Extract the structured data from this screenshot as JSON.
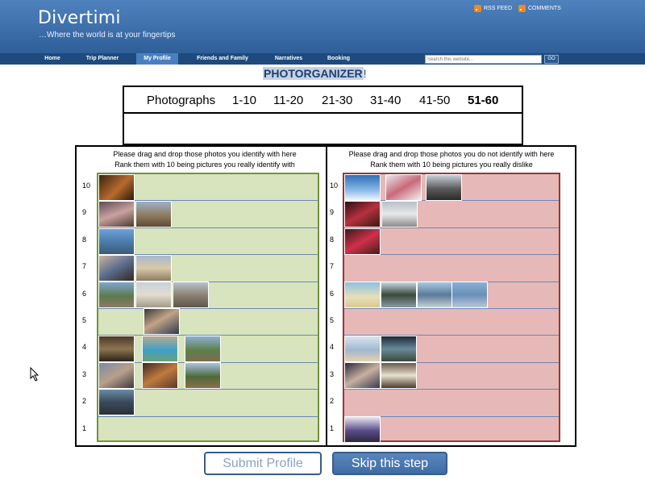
{
  "header": {
    "site_title": "Divertimi",
    "tagline": "…Where the world is at your fingertips",
    "rss_feed": "RSS FEED",
    "comments": "COMMENTS",
    "bg_color": "#3a6ba8"
  },
  "nav": {
    "items": [
      {
        "label": "Home"
      },
      {
        "label": "Trip Planner"
      },
      {
        "label": "My Profile",
        "active": true
      },
      {
        "label": "Friends and Family"
      },
      {
        "label": "Narratives"
      },
      {
        "label": "Booking"
      }
    ],
    "search_placeholder": "Search this website...",
    "go_label": "GO"
  },
  "organizer": {
    "title_word": "PHOTORGANIZER",
    "title_excl": "!",
    "ranges_prefix": "Photographs",
    "ranges": [
      "1-10",
      "11-20",
      "21-30",
      "31-40",
      "41-50",
      "51-60"
    ],
    "active_range": "51-60"
  },
  "like_panel": {
    "instruction_line1": "Please drag and drop those photos you identify with  here",
    "instruction_line2": "Rank them with 10 being pictures you really identify with",
    "color": "#d7e4bd",
    "border_color": "#76923c"
  },
  "dislike_panel": {
    "instruction_line1": "Please drag and drop those photos you do not identify with here",
    "instruction_line2": "Rank them with 10 being pictures you really dislike",
    "color": "#e6b9b8",
    "border_color": "#953735"
  },
  "row_numbers": [
    "10",
    "9",
    "8",
    "7",
    "6",
    "5",
    "4",
    "3",
    "2",
    "1"
  ],
  "buttons": {
    "submit": "Submit Profile",
    "skip": "Skip this step"
  }
}
